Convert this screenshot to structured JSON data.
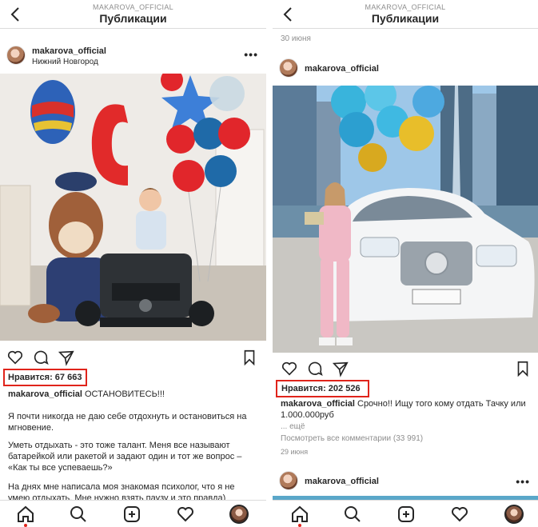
{
  "left": {
    "header": {
      "username": "MAKAROVA_OFFICIAL",
      "title": "Публикации"
    },
    "post": {
      "username": "makarova_official",
      "location": "Нижний Новгород",
      "photo_description_icon": "birthday-boy-photo",
      "likes": "Нравится: 67 663",
      "caption_user": "makarova_official",
      "caption_text": " ОСТАНОВИТЕСЬ!!!",
      "paragraphs": [
        "Я почти никогда не даю себе отдохнуть и остановиться на мгновение.",
        "Уметь отдыхать - это тоже талант. Меня все называют батарейкой или ракетой и задают один и тот же вопрос – «Как ты все успеваешь?»",
        "На днях мне написала моя знакомая психолог, что я не умею отдыхать. Мне нужно взять паузу и это правда)"
      ]
    }
  },
  "right": {
    "header": {
      "username": "MAKAROVA_OFFICIAL",
      "title": "Публикации"
    },
    "date_top": "30 июня",
    "post": {
      "username": "makarova_official",
      "likes": "Нравится: 202 526",
      "caption_user": "makarova_official",
      "caption_text": " Срочно!! Ищу того кому отдать Тачку или 1.000.000руб",
      "more": "... ещё",
      "comments": "Посмотреть все комментарии (33 991)",
      "date": "29 июня"
    },
    "next_post": {
      "username": "makarova_official"
    }
  },
  "icons": {
    "back": "chevron-left-icon",
    "more": "more-dots-icon",
    "like": "heart-icon",
    "comment": "comment-icon",
    "share": "send-icon",
    "save": "bookmark-icon",
    "nav": [
      "home-icon",
      "search-icon",
      "add-post-icon",
      "activity-heart-icon",
      "profile-avatar"
    ]
  },
  "colors": {
    "highlight": "#e0241b",
    "text": "#262626",
    "muted": "#8e8e8e"
  }
}
